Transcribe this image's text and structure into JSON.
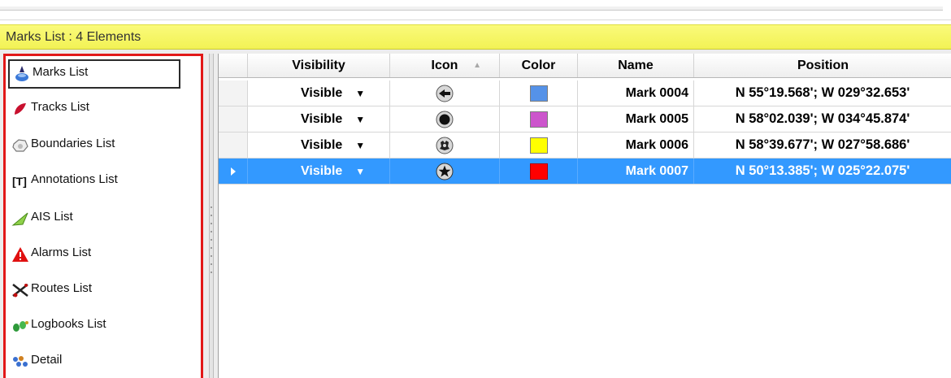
{
  "window": {
    "title": "Marks List : 4 Elements"
  },
  "sidebar": {
    "items": [
      {
        "label": "Marks List",
        "icon": "marks-icon",
        "selected": true
      },
      {
        "label": "Tracks List",
        "icon": "tracks-icon",
        "selected": false
      },
      {
        "label": "Boundaries List",
        "icon": "boundaries-icon",
        "selected": false
      },
      {
        "label": "Annotations List",
        "icon": "annotations-icon",
        "selected": false
      },
      {
        "label": "AIS List",
        "icon": "ais-icon",
        "selected": false
      },
      {
        "label": "Alarms List",
        "icon": "alarms-icon",
        "selected": false
      },
      {
        "label": "Routes List",
        "icon": "routes-icon",
        "selected": false
      },
      {
        "label": "Logbooks List",
        "icon": "logbooks-icon",
        "selected": false
      },
      {
        "label": "Detail",
        "icon": "detail-icon",
        "selected": false
      }
    ]
  },
  "table": {
    "columns": {
      "visibility": "Visibility",
      "icon": "Icon",
      "color": "Color",
      "name": "Name",
      "position": "Position"
    },
    "sort_indicator": "▲",
    "rows": [
      {
        "visibility": "Visible",
        "icon": "mark-symbol-icon",
        "color": "#5592e8",
        "name": "Mark 0004",
        "position": "N 55°19.568'; W 029°32.653'",
        "selected": false
      },
      {
        "visibility": "Visible",
        "icon": "mark-dot-icon",
        "color": "#cc55cc",
        "name": "Mark 0005",
        "position": "N 58°02.039'; W 034°45.874'",
        "selected": false
      },
      {
        "visibility": "Visible",
        "icon": "mark-emblem-icon",
        "color": "#ffff00",
        "name": "Mark 0006",
        "position": "N 58°39.677'; W 027°58.686'",
        "selected": false
      },
      {
        "visibility": "Visible",
        "icon": "mark-star-icon",
        "color": "#ff0000",
        "name": "Mark 0007",
        "position": "N 50°13.385'; W 025°22.075'",
        "selected": true
      }
    ]
  },
  "colors": {
    "title_bar": "#f5f560",
    "sidebar_border": "#e21919",
    "selection": "#3399ff"
  }
}
